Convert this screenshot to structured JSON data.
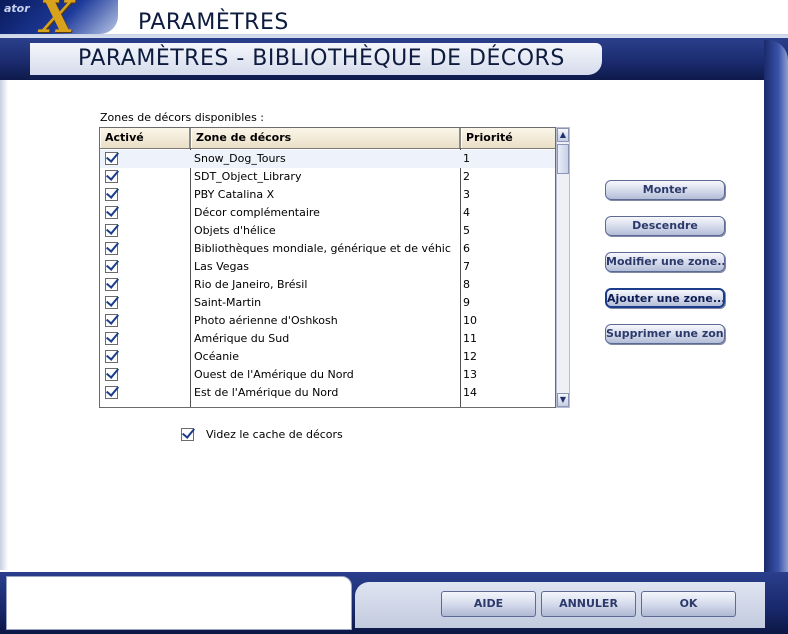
{
  "app": {
    "top_title": "PARAMÈTRES",
    "logo_text": "ator"
  },
  "header": {
    "title": "PARAMÈTRES - BIBLIOTHÈQUE DE DÉCORS"
  },
  "list": {
    "label": "Zones de décors disponibles :",
    "columns": [
      "Activé",
      "Zone de décors",
      "Priorité"
    ],
    "rows": [
      {
        "active": true,
        "name": "Snow_Dog_Tours",
        "priority": "1"
      },
      {
        "active": true,
        "name": "SDT_Object_Library",
        "priority": "2"
      },
      {
        "active": true,
        "name": "PBY Catalina X",
        "priority": "3"
      },
      {
        "active": true,
        "name": "Décor complémentaire",
        "priority": "4"
      },
      {
        "active": true,
        "name": "Objets d'hélice",
        "priority": "5"
      },
      {
        "active": true,
        "name": "Bibliothèques mondiale, générique et de véhic",
        "priority": "6"
      },
      {
        "active": true,
        "name": "Las Vegas",
        "priority": "7"
      },
      {
        "active": true,
        "name": "Rio de Janeiro, Brésil",
        "priority": "8"
      },
      {
        "active": true,
        "name": "Saint-Martin",
        "priority": "9"
      },
      {
        "active": true,
        "name": "Photo aérienne d'Oshkosh",
        "priority": "10"
      },
      {
        "active": true,
        "name": "Amérique du Sud",
        "priority": "11"
      },
      {
        "active": true,
        "name": "Océanie",
        "priority": "12"
      },
      {
        "active": true,
        "name": "Ouest de l'Amérique du Nord",
        "priority": "13"
      },
      {
        "active": true,
        "name": "Est de l'Amérique du Nord",
        "priority": "14"
      }
    ]
  },
  "buttons": {
    "up": "Monter",
    "down": "Descendre",
    "edit": "Modifier une zone...",
    "add": "Ajouter une zone...",
    "remove": "Supprimer une zone"
  },
  "cache": {
    "checked": true,
    "label": "Videz le cache de décors"
  },
  "footer": {
    "help": "AIDE",
    "cancel": "ANNULER",
    "ok": "OK"
  },
  "icons": {
    "scroll_up": "scroll-up-arrow-icon",
    "scroll_down": "scroll-down-arrow-icon",
    "checkbox": "checkmark-icon"
  },
  "colors": {
    "frame_blue": "#1a2a6c",
    "checkmark": "#1b3d8a",
    "header_bg": "#eadfc6",
    "logo_gold": "#d9a21c"
  }
}
